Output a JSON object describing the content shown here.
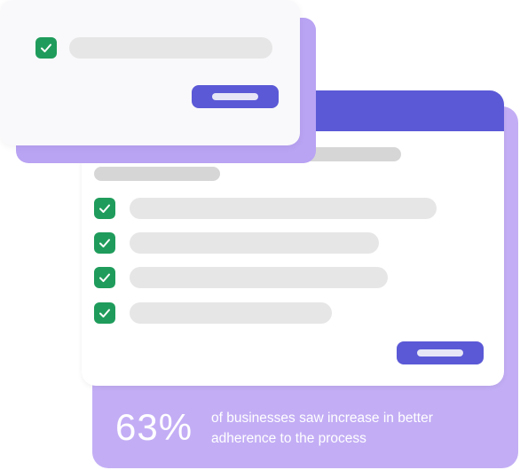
{
  "stat": {
    "value": "63%",
    "text": "of businesses saw increase in better adherence to the process"
  },
  "colors": {
    "accent": "#5b59d6",
    "lavender": "#c3aef5",
    "check_green": "#1f9c5b",
    "placeholder_gray": "#e6e6e6"
  },
  "icons": {
    "check": "checkmark-icon"
  }
}
